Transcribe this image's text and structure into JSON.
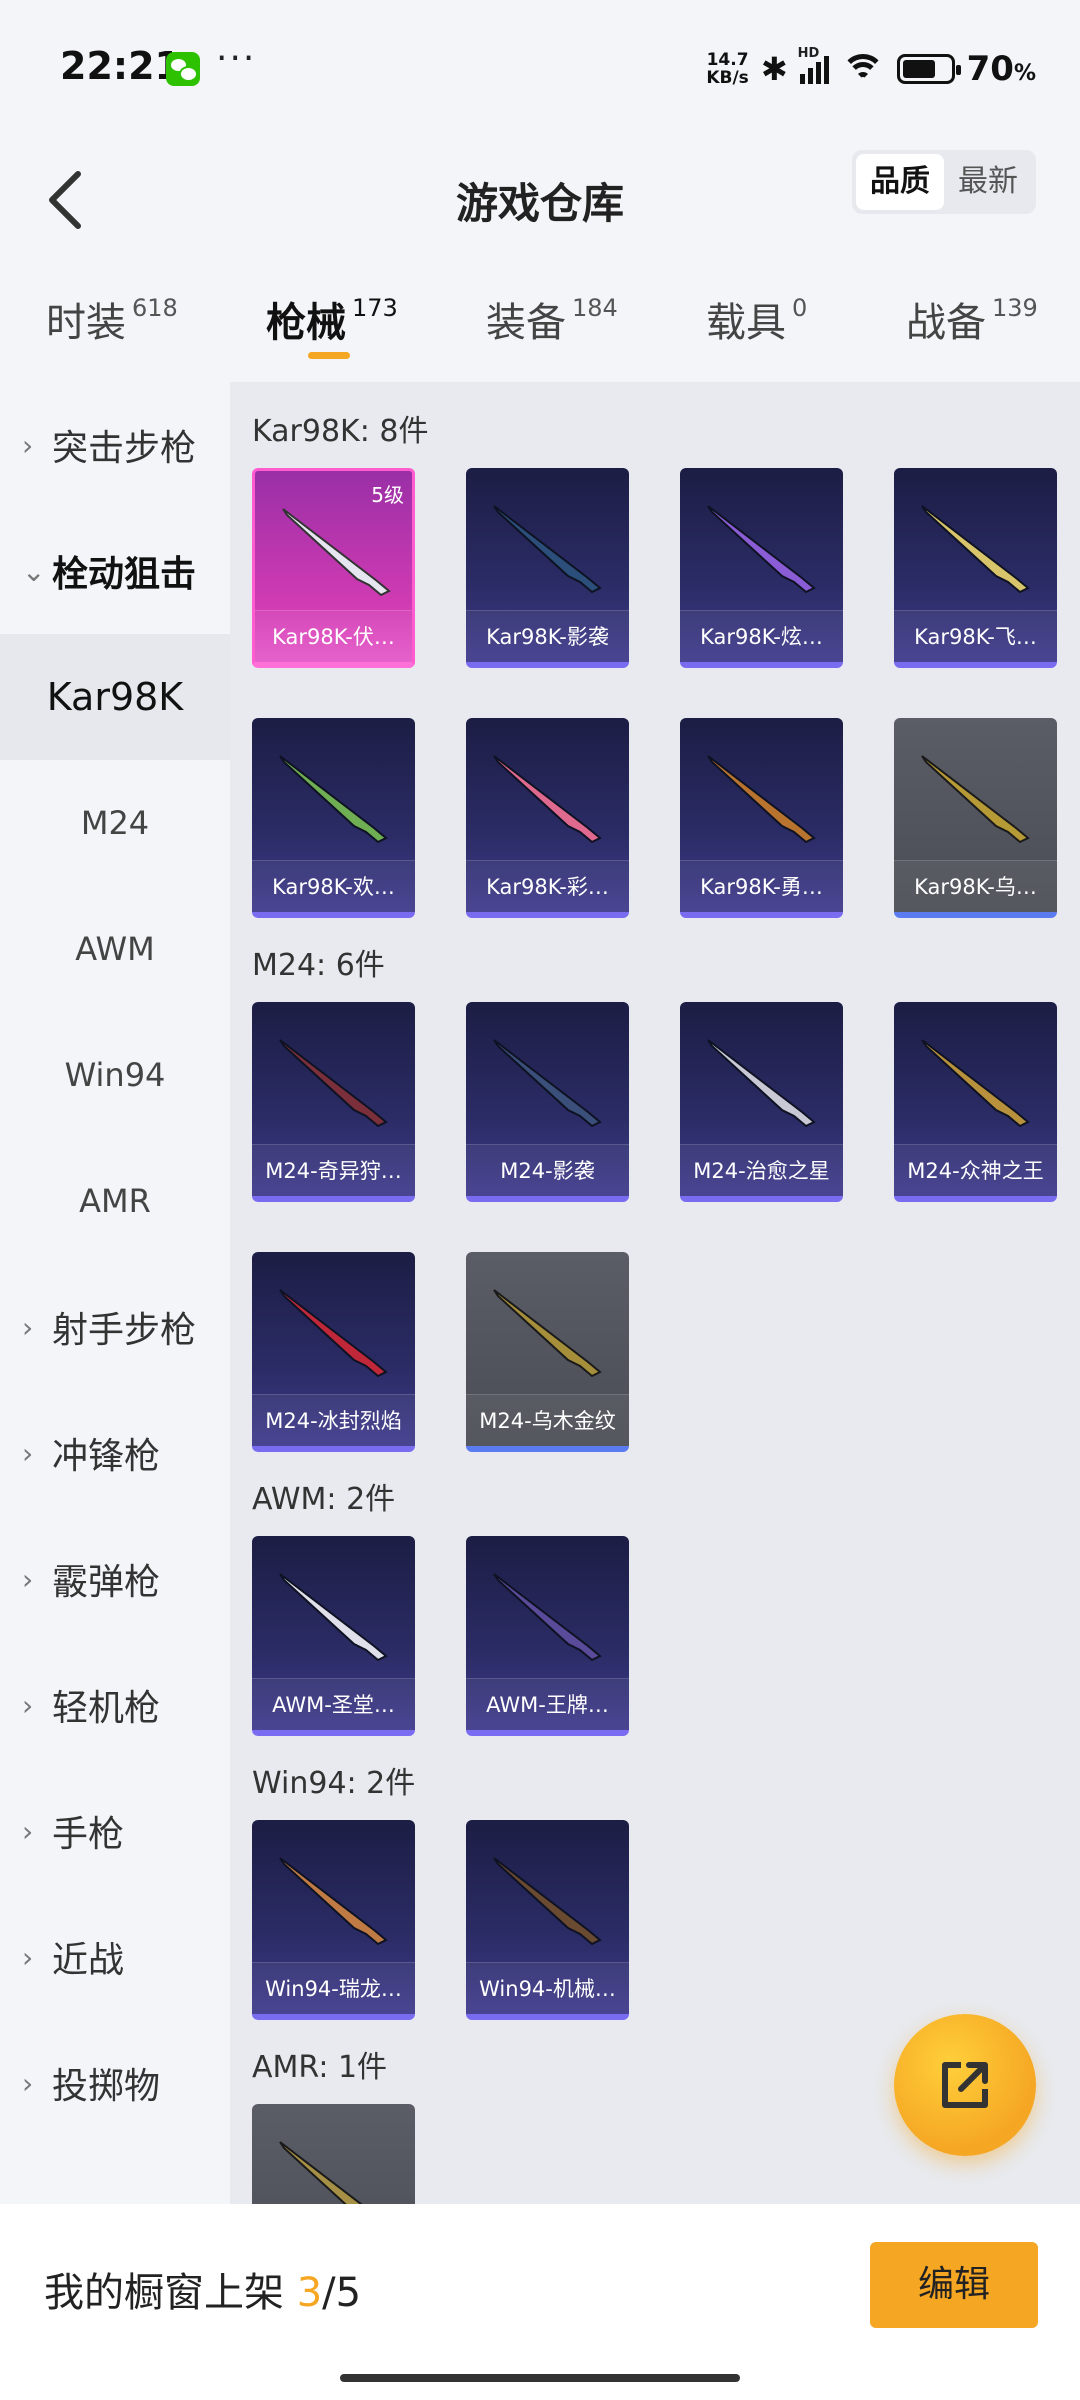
{
  "status_bar": {
    "time": "22:21",
    "dots": "···",
    "net_speed_value": "14.7",
    "net_speed_unit": "KB/s",
    "signal_label": "HD",
    "battery_percent": "70",
    "battery_unit": "%",
    "battery_level": 0.7,
    "icons": [
      "wechat-icon",
      "bluetooth-icon",
      "signal-icon",
      "wifi-icon",
      "battery-icon"
    ]
  },
  "header": {
    "title": "游戏仓库",
    "sort_options": [
      "品质",
      "最新"
    ],
    "sort_selected": "品质"
  },
  "tabs": [
    {
      "label": "时装",
      "count": "618"
    },
    {
      "label": "枪械",
      "count": "173",
      "active": true
    },
    {
      "label": "装备",
      "count": "184"
    },
    {
      "label": "载具",
      "count": "0"
    },
    {
      "label": "战备",
      "count": "139"
    }
  ],
  "sidebar": {
    "categories": [
      {
        "label": "突击步枪",
        "chevron": "›"
      },
      {
        "label": "栓动狙击",
        "chevron": "⌄",
        "expanded": true
      },
      {
        "label": "射手步枪",
        "chevron": "›"
      },
      {
        "label": "冲锋枪",
        "chevron": "›"
      },
      {
        "label": "霰弹枪",
        "chevron": "›"
      },
      {
        "label": "轻机枪",
        "chevron": "›"
      },
      {
        "label": "手枪",
        "chevron": "›"
      },
      {
        "label": "近战",
        "chevron": "›"
      },
      {
        "label": "投掷物",
        "chevron": "›"
      }
    ],
    "subitems": [
      "Kar98K",
      "M24",
      "AWM",
      "Win94",
      "AMR"
    ],
    "selected_subitem": "Kar98K"
  },
  "groups": [
    {
      "title": "Kar98K: 8件",
      "items": [
        {
          "name": "Kar98K-伏…",
          "level": "5级",
          "rarity": "gold"
        },
        {
          "name": "Kar98K-影袭",
          "rarity": "purple"
        },
        {
          "name": "Kar98K-炫…",
          "rarity": "purple"
        },
        {
          "name": "Kar98K-飞…",
          "rarity": "purple"
        },
        {
          "name": "Kar98K-欢…",
          "rarity": "purple"
        },
        {
          "name": "Kar98K-彩…",
          "rarity": "purple"
        },
        {
          "name": "Kar98K-勇…",
          "rarity": "purple"
        },
        {
          "name": "Kar98K-乌…",
          "rarity": "grey"
        }
      ]
    },
    {
      "title": "M24: 6件",
      "items": [
        {
          "name": "M24-奇异狩…",
          "rarity": "purple"
        },
        {
          "name": "M24-影袭",
          "rarity": "purple"
        },
        {
          "name": "M24-治愈之星",
          "rarity": "purple"
        },
        {
          "name": "M24-众神之王",
          "rarity": "purple"
        },
        {
          "name": "M24-冰封烈焰",
          "rarity": "purple"
        },
        {
          "name": "M24-乌木金纹",
          "rarity": "grey"
        }
      ]
    },
    {
      "title": "AWM: 2件",
      "items": [
        {
          "name": "AWM-圣堂…",
          "rarity": "purple"
        },
        {
          "name": "AWM-王牌…",
          "rarity": "purple"
        }
      ]
    },
    {
      "title": "Win94: 2件",
      "items": [
        {
          "name": "Win94-瑞龙…",
          "rarity": "purple"
        },
        {
          "name": "Win94-机械…",
          "rarity": "purple"
        }
      ]
    },
    {
      "title": "AMR: 1件",
      "items": [
        {
          "name": "",
          "rarity": "grey"
        }
      ]
    }
  ],
  "bottom_bar": {
    "shelf_label": "我的橱窗上架",
    "shelf_current": "3",
    "shelf_total": "/5",
    "edit_label": "编辑"
  },
  "colors": {
    "accent": "#f5a623",
    "purple_card": "#2b2c66",
    "gold_card": "#d13bb3",
    "grey_card": "#55575f"
  }
}
